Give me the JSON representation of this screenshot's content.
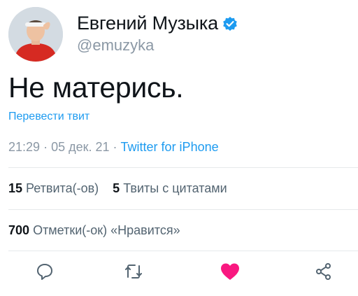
{
  "user": {
    "display_name": "Евгений Музыка",
    "handle": "@emuzyka",
    "verified": true
  },
  "tweet": {
    "text": "Не матерись.",
    "translate_label": "Перевести твит",
    "time": "21:29",
    "date": "05 дек. 21",
    "source": "Twitter for iPhone",
    "separator": "·"
  },
  "stats": {
    "retweets_count": "15",
    "retweets_label": "Ретвита(-ов)",
    "quotes_count": "5",
    "quotes_label": "Твиты с цитатами",
    "likes_count": "700",
    "likes_label": "Отметки(-ок) «Нравится»"
  },
  "actions": {
    "reply_icon": "reply-icon",
    "retweet_icon": "retweet-icon",
    "like_icon": "heart-icon",
    "share_icon": "share-icon"
  },
  "colors": {
    "accent": "#1d9bf0",
    "like": "#f91880",
    "muted": "#8b98a5"
  }
}
